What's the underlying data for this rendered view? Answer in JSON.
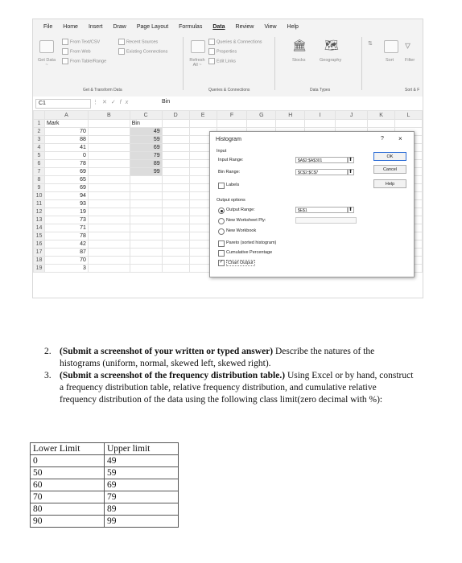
{
  "ribbon": {
    "tabs": [
      "File",
      "Home",
      "Insert",
      "Draw",
      "Page Layout",
      "Formulas",
      "Data",
      "Review",
      "View",
      "Help"
    ],
    "active_tab": "Data",
    "get_data": "Get Data ~",
    "from_text_csv": "From Text/CSV",
    "from_web": "From Web",
    "from_table_range": "From Table/Range",
    "recent_sources": "Recent Sources",
    "existing_connections": "Existing Connections",
    "group_get_transform": "Get & Transform Data",
    "refresh_all": "Refresh All ~",
    "queries_connections": "Queries & Connections",
    "properties": "Properties",
    "edit_links": "Edit Links",
    "group_queries": "Queries & Connections",
    "stocks": "Stocks",
    "geography": "Geography",
    "group_data_types": "Data Types",
    "sort": "Sort",
    "filter": "Filter",
    "group_sort": "Sort & F"
  },
  "formula_bar": {
    "name_box": "C1",
    "content": "Bin"
  },
  "sheet": {
    "columns": [
      "A",
      "B",
      "C",
      "D",
      "E",
      "F",
      "G",
      "H",
      "I",
      "J",
      "K",
      "L"
    ],
    "rows": [
      {
        "num": "1",
        "a": "Mark",
        "c": "Bin"
      },
      {
        "num": "2",
        "a": "70",
        "c": "49"
      },
      {
        "num": "3",
        "a": "88",
        "c": "59"
      },
      {
        "num": "4",
        "a": "41",
        "c": "69"
      },
      {
        "num": "5",
        "a": "0",
        "c": "79"
      },
      {
        "num": "6",
        "a": "78",
        "c": "89"
      },
      {
        "num": "7",
        "a": "69",
        "c": "99"
      },
      {
        "num": "8",
        "a": "65",
        "c": ""
      },
      {
        "num": "9",
        "a": "69",
        "c": ""
      },
      {
        "num": "10",
        "a": "94",
        "c": ""
      },
      {
        "num": "11",
        "a": "93",
        "c": ""
      },
      {
        "num": "12",
        "a": "19",
        "c": ""
      },
      {
        "num": "13",
        "a": "73",
        "c": ""
      },
      {
        "num": "14",
        "a": "71",
        "c": ""
      },
      {
        "num": "15",
        "a": "78",
        "c": ""
      },
      {
        "num": "16",
        "a": "42",
        "c": ""
      },
      {
        "num": "17",
        "a": "87",
        "c": ""
      },
      {
        "num": "18",
        "a": "70",
        "c": ""
      },
      {
        "num": "19",
        "a": "3",
        "c": ""
      }
    ]
  },
  "dialog": {
    "title": "Histogram",
    "help_glyph": "?",
    "close_glyph": "×",
    "input_section": "Input",
    "input_range_label": "Input Range:",
    "input_range_value": "$A$2:$A$301",
    "bin_range_label": "Bin Range:",
    "bin_range_value": "$C$2:$C$7",
    "labels_label": "Labels",
    "output_section": "Output options",
    "output_range_label": "Output Range:",
    "output_range_value": "$E$1",
    "new_worksheet_label": "New Worksheet Ply:",
    "new_workbook_label": "New Workbook",
    "pareto_label": "Pareto (sorted histogram)",
    "cumulative_label": "Cumulative Percentage",
    "chart_output_label": "Chart Output",
    "ok": "OK",
    "cancel": "Cancel",
    "help": "Help"
  },
  "questions": [
    {
      "number": "2.",
      "bold": "(Submit a screenshot of your written or typed answer)",
      "text": " Describe the natures of the histograms (uniform, normal, skewed left, skewed right)."
    },
    {
      "number": "3.",
      "bold": "(Submit a screenshot of the frequency distribution table.)",
      "text": " Using Excel or by hand, construct a frequency distribution table, relative frequency distribution, and cumulative relative frequency distribution of the data using the following class limit(zero decimal with %):"
    }
  ],
  "limits_table": {
    "headers": [
      "Lower Limit",
      "Upper limit"
    ],
    "rows": [
      [
        "0",
        "49"
      ],
      [
        "50",
        "59"
      ],
      [
        "60",
        "69"
      ],
      [
        "70",
        "79"
      ],
      [
        "80",
        "89"
      ],
      [
        "90",
        "99"
      ]
    ]
  }
}
